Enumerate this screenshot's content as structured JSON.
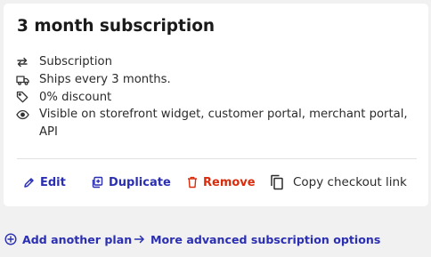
{
  "card": {
    "title": "3 month subscription",
    "details": [
      {
        "icon": "repeat-icon",
        "text": "Subscription"
      },
      {
        "icon": "truck-icon",
        "text": "Ships every 3 months."
      },
      {
        "icon": "tag-icon",
        "text": "0% discount"
      },
      {
        "icon": "eye-icon",
        "text": "Visible on storefront widget, customer portal, merchant portal, API"
      }
    ],
    "actions": {
      "edit_label": "Edit",
      "duplicate_label": "Duplicate",
      "remove_label": "Remove",
      "copy_label": "Copy checkout link"
    }
  },
  "links": {
    "add_plan_label": "Add another plan",
    "advanced_label": "More advanced subscription options"
  },
  "colors": {
    "accent": "#2b2fb2",
    "danger": "#d82c0d",
    "text": "#2b2b2b",
    "background": "#f1f1f1",
    "card": "#ffffff"
  }
}
